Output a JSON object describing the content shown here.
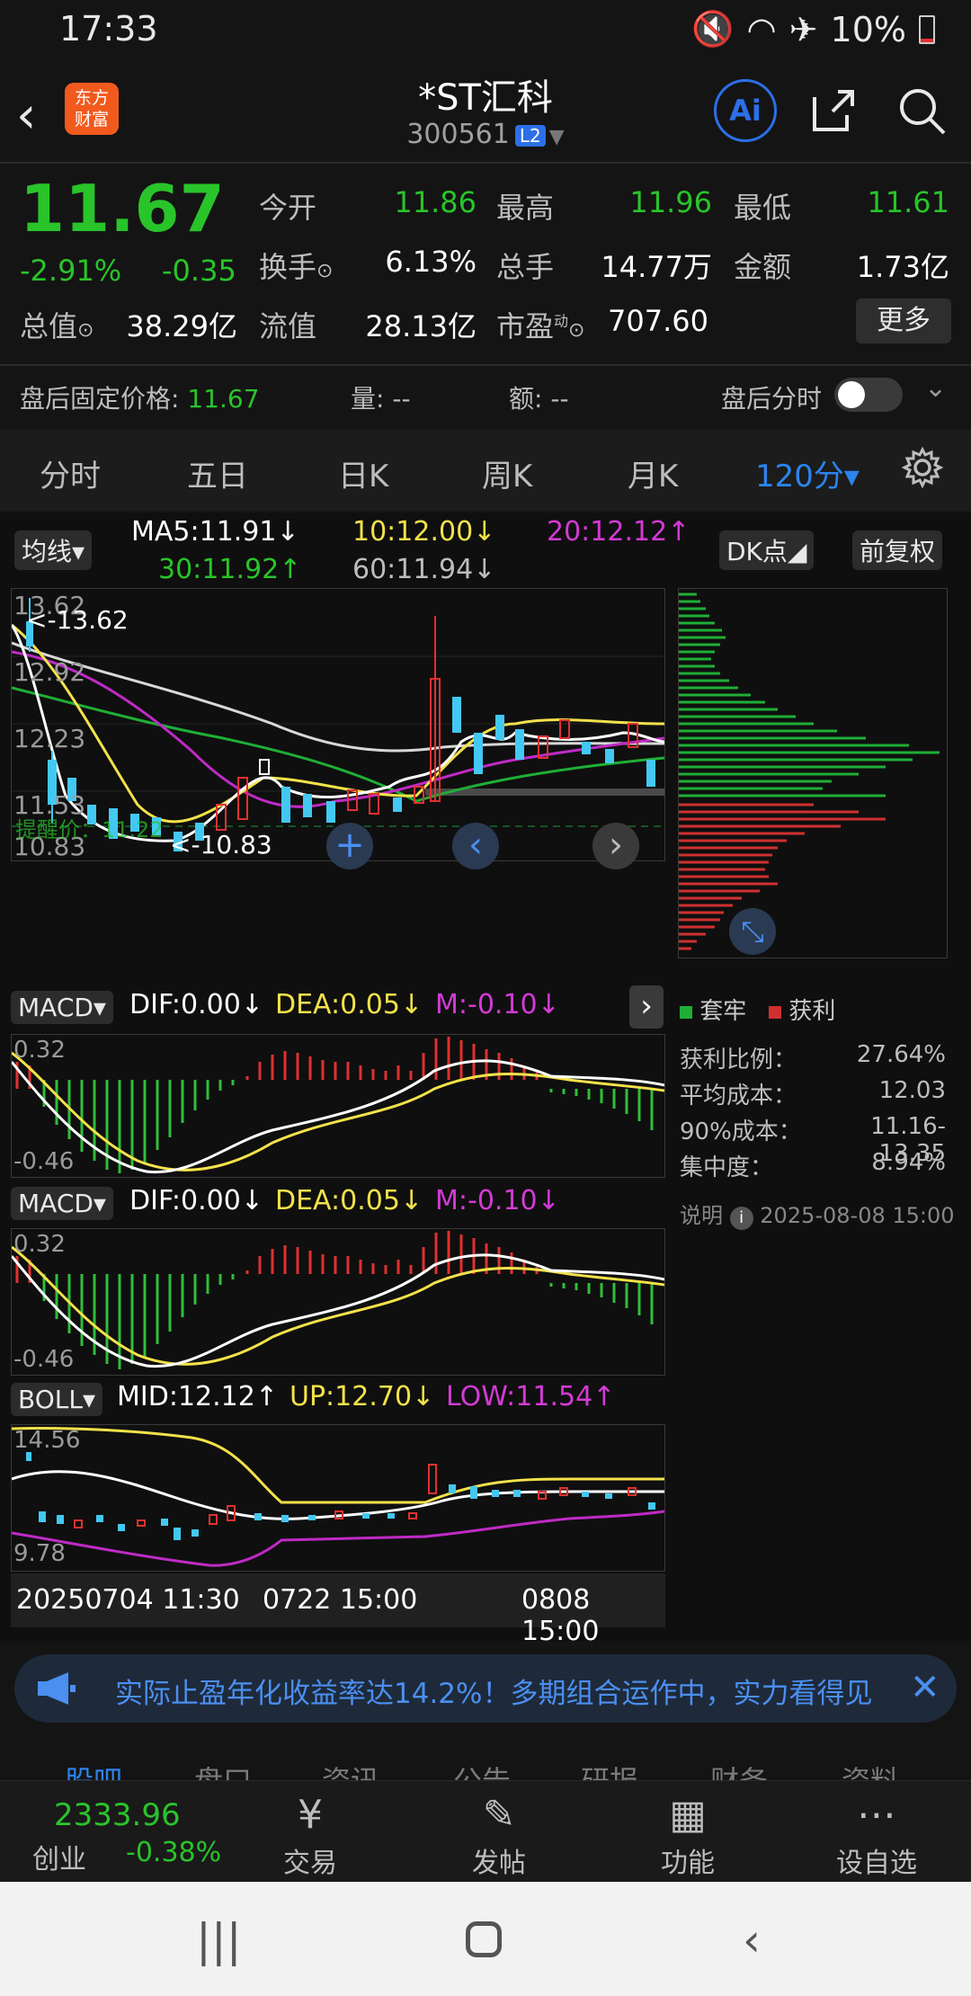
{
  "status_bar": {
    "time": "17:33",
    "battery": "10%"
  },
  "header": {
    "logo_line1": "东方",
    "logo_line2": "财富",
    "title": "*ST汇科",
    "code": "300561",
    "level_badge": "L2",
    "ai_label": "Ai"
  },
  "quote": {
    "price": "11.67",
    "change_pct": "-2.91%",
    "change": "-0.35",
    "rows": [
      [
        {
          "label": "今开",
          "value": "11.86",
          "color": "#29c42a"
        },
        {
          "label": "最高",
          "value": "11.96",
          "color": "#29c42a"
        },
        {
          "label": "最低",
          "value": "11.61",
          "color": "#29c42a"
        }
      ],
      [
        {
          "label": "换手",
          "value": "6.13%",
          "color": "#ffffff"
        },
        {
          "label": "总手",
          "value": "14.77万",
          "color": "#ffffff"
        },
        {
          "label": "金额",
          "value": "1.73亿",
          "color": "#ffffff"
        }
      ]
    ],
    "row3": {
      "total_label": "总值",
      "total_value": "38.29亿",
      "float_label": "流值",
      "float_value": "28.13亿",
      "pe_label": "市盈",
      "pe_sup": "动",
      "pe_value": "707.60"
    },
    "more_button": "更多"
  },
  "after_hours": {
    "label": "盘后固定价格:",
    "price": "11.67",
    "vol_label": "量:",
    "vol": "--",
    "amt_label": "额:",
    "amt": "--",
    "timeshare_label": "盘后分时"
  },
  "period_tabs": [
    "分时",
    "五日",
    "日K",
    "周K",
    "月K",
    "120分▾"
  ],
  "active_tab": 5,
  "ma_line": {
    "pill": "均线▾",
    "ma5": "MA5:11.91↓",
    "ma10": "10:12.00↓",
    "ma20": "20:12.12↑",
    "ma30": "30:11.92↑",
    "ma60": "60:11.94↓",
    "dk_pill": "DK点◢",
    "adj_pill": "前复权"
  },
  "main_chart": {
    "y_labels": [
      "13.62",
      "12.92",
      "12.23",
      "11.53",
      "10.83"
    ],
    "max_marker": "<-13.62",
    "min_marker": "<-10.83",
    "alert": "提醒价：11.22"
  },
  "macd1": {
    "pill": "MACD▾",
    "dif": "DIF:0.00↓",
    "dea": "DEA:0.05↓",
    "m": "M:-0.10↓",
    "y_top": "0.32",
    "y_bottom": "-0.46"
  },
  "macd2": {
    "pill": "MACD▾",
    "dif": "DIF:0.00↓",
    "dea": "DEA:0.05↓",
    "m": "M:-0.10↓",
    "y_top": "0.32",
    "y_bottom": "-0.46"
  },
  "boll": {
    "pill": "BOLL▾",
    "mid": "MID:12.12↑",
    "up": "UP:12.70↓",
    "low": "LOW:11.54↑",
    "y_top": "14.56",
    "y_bottom": "9.78"
  },
  "x_axis": [
    "20250704 11:30",
    "0722 15:00",
    "0808 15:00"
  ],
  "chip": {
    "legend_loss": "套牢",
    "legend_profit": "获利",
    "stats": [
      {
        "label": "获利比例：",
        "value": "27.64%"
      },
      {
        "label": "平均成本：",
        "value": "12.03"
      },
      {
        "label": "90%成本：",
        "value": "11.16-13.35"
      },
      {
        "label": "集中度：",
        "value": "8.94%"
      }
    ],
    "note_label": "说明",
    "note_time": "2025-08-08 15:00"
  },
  "banner": {
    "text": "实际止盈年化收益率达14.2%！多期组合运作中，实力看得见"
  },
  "sub_tabs": [
    "股吧",
    "盘口",
    "资讯",
    "公告",
    "研报",
    "财务",
    "资料"
  ],
  "bottom_nav": {
    "index_value": "2333.96",
    "index_name": "创业",
    "index_change": "-0.38%",
    "items": [
      {
        "icon": "¥",
        "label": "交易"
      },
      {
        "icon": "✎",
        "label": "发帖"
      },
      {
        "icon": "▦",
        "label": "功能"
      },
      {
        "icon": "⋯",
        "label": "设自选"
      }
    ]
  }
}
